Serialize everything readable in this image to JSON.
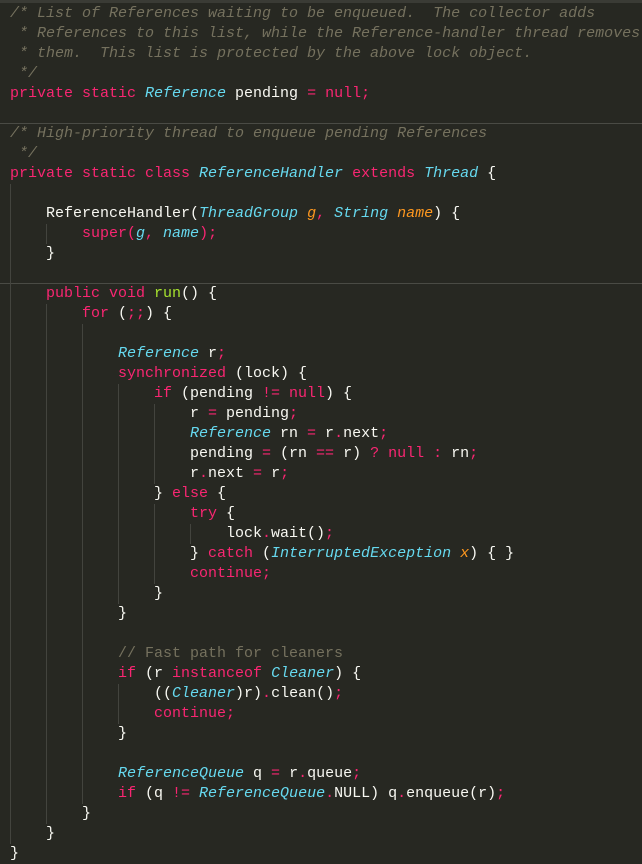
{
  "lines": [
    {
      "indent": 0,
      "tokens": [
        [
          "c",
          "/* List of References waiting to be enqueued.  The collector adds"
        ]
      ]
    },
    {
      "indent": 0,
      "tokens": [
        [
          "c",
          " * References to this list, while the Reference-handler thread removes"
        ]
      ]
    },
    {
      "indent": 0,
      "tokens": [
        [
          "c",
          " * them.  This list is protected by the above lock object."
        ]
      ]
    },
    {
      "indent": 0,
      "tokens": [
        [
          "c",
          " */"
        ]
      ]
    },
    {
      "indent": 0,
      "tokens": [
        [
          "k",
          "private static "
        ],
        [
          "t",
          "Reference"
        ],
        [
          "p",
          " pending "
        ],
        [
          "k",
          "= null;"
        ]
      ]
    },
    {
      "indent": 0,
      "tokens": [],
      "divider": true
    },
    {
      "indent": 0,
      "tokens": [
        [
          "c",
          "/* High-priority thread to enqueue pending References"
        ]
      ]
    },
    {
      "indent": 0,
      "tokens": [
        [
          "c",
          " */"
        ]
      ]
    },
    {
      "indent": 0,
      "tokens": [
        [
          "k",
          "private static class "
        ],
        [
          "t",
          "ReferenceHandler"
        ],
        [
          "k",
          " extends "
        ],
        [
          "t",
          "Thread"
        ],
        [
          "p",
          " {"
        ]
      ]
    },
    {
      "indent": 1,
      "tokens": []
    },
    {
      "indent": 1,
      "tokens": [
        [
          "p",
          "ReferenceHandler("
        ],
        [
          "t",
          "ThreadGroup "
        ],
        [
          "a",
          "g"
        ],
        [
          "k",
          ", "
        ],
        [
          "t",
          "String "
        ],
        [
          "a",
          "name"
        ],
        [
          "p",
          ") {"
        ]
      ]
    },
    {
      "indent": 2,
      "tokens": [
        [
          "k",
          "super("
        ],
        [
          "v",
          "g"
        ],
        [
          "k",
          ", "
        ],
        [
          "v",
          "name"
        ],
        [
          "k",
          ");"
        ]
      ]
    },
    {
      "indent": 1,
      "tokens": [
        [
          "p",
          "}"
        ]
      ]
    },
    {
      "indent": 1,
      "tokens": [],
      "divider": true
    },
    {
      "indent": 1,
      "tokens": [
        [
          "k",
          "public void "
        ],
        [
          "f",
          "run"
        ],
        [
          "p",
          "() {"
        ]
      ]
    },
    {
      "indent": 2,
      "tokens": [
        [
          "k",
          "for "
        ],
        [
          "p",
          "("
        ],
        [
          "k",
          ";;"
        ],
        [
          "p",
          ") {"
        ]
      ]
    },
    {
      "indent": 3,
      "tokens": []
    },
    {
      "indent": 3,
      "tokens": [
        [
          "t",
          "Reference"
        ],
        [
          "p",
          " r"
        ],
        [
          "k",
          ";"
        ]
      ]
    },
    {
      "indent": 3,
      "tokens": [
        [
          "k",
          "synchronized "
        ],
        [
          "p",
          "(lock) {"
        ]
      ]
    },
    {
      "indent": 4,
      "tokens": [
        [
          "k",
          "if "
        ],
        [
          "p",
          "(pending "
        ],
        [
          "k",
          "!= null"
        ],
        [
          "p",
          ") {"
        ]
      ]
    },
    {
      "indent": 5,
      "tokens": [
        [
          "p",
          "r "
        ],
        [
          "k",
          "= "
        ],
        [
          "p",
          "pending"
        ],
        [
          "k",
          ";"
        ]
      ]
    },
    {
      "indent": 5,
      "tokens": [
        [
          "t",
          "Reference"
        ],
        [
          "p",
          " rn "
        ],
        [
          "k",
          "= "
        ],
        [
          "p",
          "r"
        ],
        [
          "k",
          "."
        ],
        [
          "p",
          "next"
        ],
        [
          "k",
          ";"
        ]
      ]
    },
    {
      "indent": 5,
      "tokens": [
        [
          "p",
          "pending "
        ],
        [
          "k",
          "= "
        ],
        [
          "p",
          "(rn "
        ],
        [
          "k",
          "== "
        ],
        [
          "p",
          "r) "
        ],
        [
          "k",
          "? null : "
        ],
        [
          "p",
          "rn"
        ],
        [
          "k",
          ";"
        ]
      ]
    },
    {
      "indent": 5,
      "tokens": [
        [
          "p",
          "r"
        ],
        [
          "k",
          "."
        ],
        [
          "p",
          "next "
        ],
        [
          "k",
          "= "
        ],
        [
          "p",
          "r"
        ],
        [
          "k",
          ";"
        ]
      ]
    },
    {
      "indent": 4,
      "tokens": [
        [
          "p",
          "} "
        ],
        [
          "k",
          "else "
        ],
        [
          "p",
          "{"
        ]
      ]
    },
    {
      "indent": 5,
      "tokens": [
        [
          "k",
          "try "
        ],
        [
          "p",
          "{"
        ]
      ]
    },
    {
      "indent": 6,
      "tokens": [
        [
          "p",
          "lock"
        ],
        [
          "k",
          "."
        ],
        [
          "p",
          "wait()"
        ],
        [
          "k",
          ";"
        ]
      ]
    },
    {
      "indent": 5,
      "tokens": [
        [
          "p",
          "} "
        ],
        [
          "k",
          "catch "
        ],
        [
          "p",
          "("
        ],
        [
          "t",
          "InterruptedException "
        ],
        [
          "a",
          "x"
        ],
        [
          "p",
          ") { }"
        ]
      ]
    },
    {
      "indent": 5,
      "tokens": [
        [
          "k",
          "continue;"
        ]
      ]
    },
    {
      "indent": 4,
      "tokens": [
        [
          "p",
          "}"
        ]
      ]
    },
    {
      "indent": 3,
      "tokens": [
        [
          "p",
          "}"
        ]
      ]
    },
    {
      "indent": 3,
      "tokens": []
    },
    {
      "indent": 3,
      "tokens": [
        [
          "cl",
          "// Fast path for cleaners"
        ]
      ]
    },
    {
      "indent": 3,
      "tokens": [
        [
          "k",
          "if "
        ],
        [
          "p",
          "(r "
        ],
        [
          "k",
          "instanceof "
        ],
        [
          "t",
          "Cleaner"
        ],
        [
          "p",
          ") {"
        ]
      ]
    },
    {
      "indent": 4,
      "tokens": [
        [
          "p",
          "(("
        ],
        [
          "t",
          "Cleaner"
        ],
        [
          "p",
          ")r)"
        ],
        [
          "k",
          "."
        ],
        [
          "p",
          "clean()"
        ],
        [
          "k",
          ";"
        ]
      ]
    },
    {
      "indent": 4,
      "tokens": [
        [
          "k",
          "continue;"
        ]
      ]
    },
    {
      "indent": 3,
      "tokens": [
        [
          "p",
          "}"
        ]
      ]
    },
    {
      "indent": 3,
      "tokens": []
    },
    {
      "indent": 3,
      "tokens": [
        [
          "t",
          "ReferenceQueue"
        ],
        [
          "p",
          " q "
        ],
        [
          "k",
          "= "
        ],
        [
          "p",
          "r"
        ],
        [
          "k",
          "."
        ],
        [
          "p",
          "queue"
        ],
        [
          "k",
          ";"
        ]
      ]
    },
    {
      "indent": 3,
      "tokens": [
        [
          "k",
          "if "
        ],
        [
          "p",
          "(q "
        ],
        [
          "k",
          "!= "
        ],
        [
          "t",
          "ReferenceQueue"
        ],
        [
          "k",
          "."
        ],
        [
          "p",
          "NULL) q"
        ],
        [
          "k",
          "."
        ],
        [
          "p",
          "enqueue(r)"
        ],
        [
          "k",
          ";"
        ]
      ]
    },
    {
      "indent": 2,
      "tokens": [
        [
          "p",
          "}"
        ]
      ]
    },
    {
      "indent": 1,
      "tokens": [
        [
          "p",
          "}"
        ]
      ]
    },
    {
      "indent": 0,
      "tokens": [
        [
          "p",
          "}"
        ]
      ]
    }
  ]
}
